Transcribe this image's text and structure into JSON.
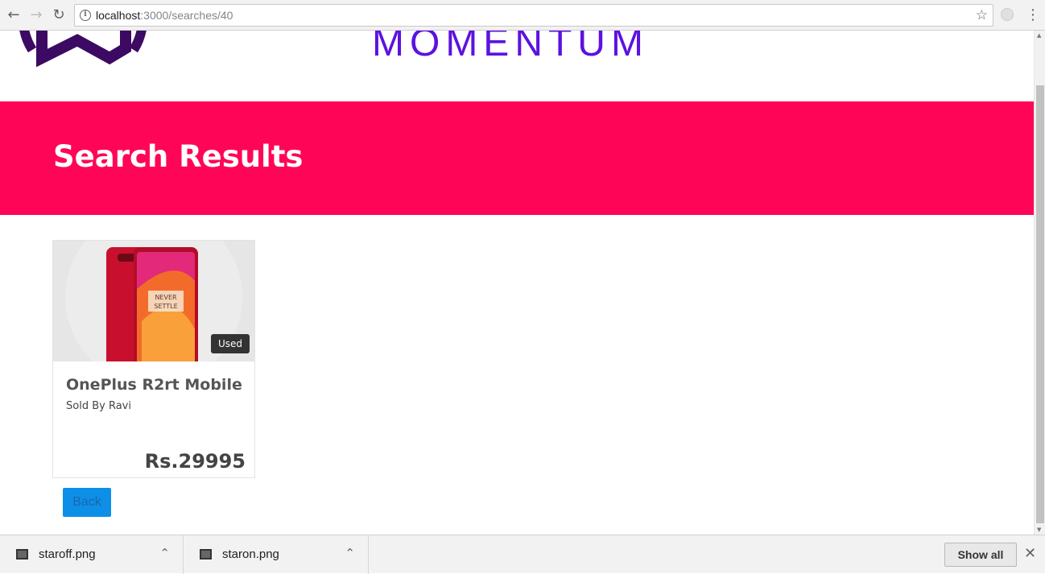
{
  "browser": {
    "url_host": "localhost",
    "url_path": ":3000/searches/40"
  },
  "header": {
    "brand": "MOMENTUM"
  },
  "hero": {
    "title": "Search Results"
  },
  "results": [
    {
      "title": "OnePlus R2rt Mobile",
      "seller": "Sold By Ravi",
      "price": "Rs.29995",
      "badge": "Used"
    }
  ],
  "actions": {
    "back_label": "Back"
  },
  "downloads": {
    "items": [
      {
        "name": "staroff.png"
      },
      {
        "name": "staron.png"
      }
    ],
    "show_all_label": "Show all"
  },
  "colors": {
    "hero_bg": "#ff0558",
    "brand": "#5b12e0",
    "logo": "#3d0a63",
    "button": "#0d8fe8"
  }
}
